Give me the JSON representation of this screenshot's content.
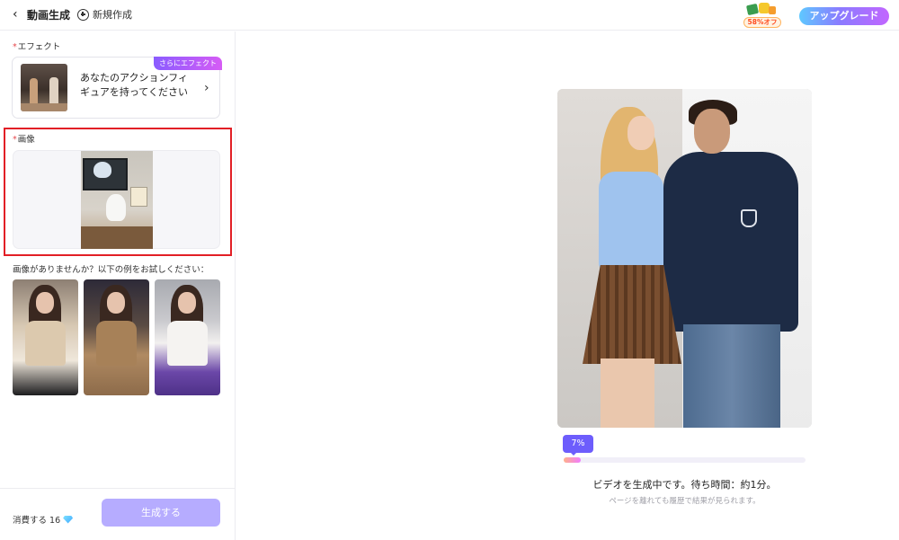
{
  "header": {
    "back_icon": "chevron-left-icon",
    "title": "動画生成",
    "new_label": "新規作成",
    "promo_label": "58%オフ",
    "upgrade_label": "アップグレード"
  },
  "effect": {
    "required_mark": "*",
    "label": "エフェクト",
    "badge": "さらにエフェクト",
    "name": "あなたのアクションフィギュアを持ってください"
  },
  "image_section": {
    "required_mark": "*",
    "label": "画像"
  },
  "samples": {
    "prompt": "画像がありませんか？以下の例をお試しください："
  },
  "footer": {
    "cost_label": "消費する 16",
    "generate_label": "生成する"
  },
  "progress": {
    "percent_label": "7%",
    "fraction": 0.07,
    "status": "ビデオを生成中です。待ち時間：約1分。",
    "note": "ページを離れても履歴で結果が見られます。"
  },
  "colors": {
    "accent": "#6d5dfc",
    "button_disabled": "#b6acff",
    "highlight": "#e21f26"
  }
}
